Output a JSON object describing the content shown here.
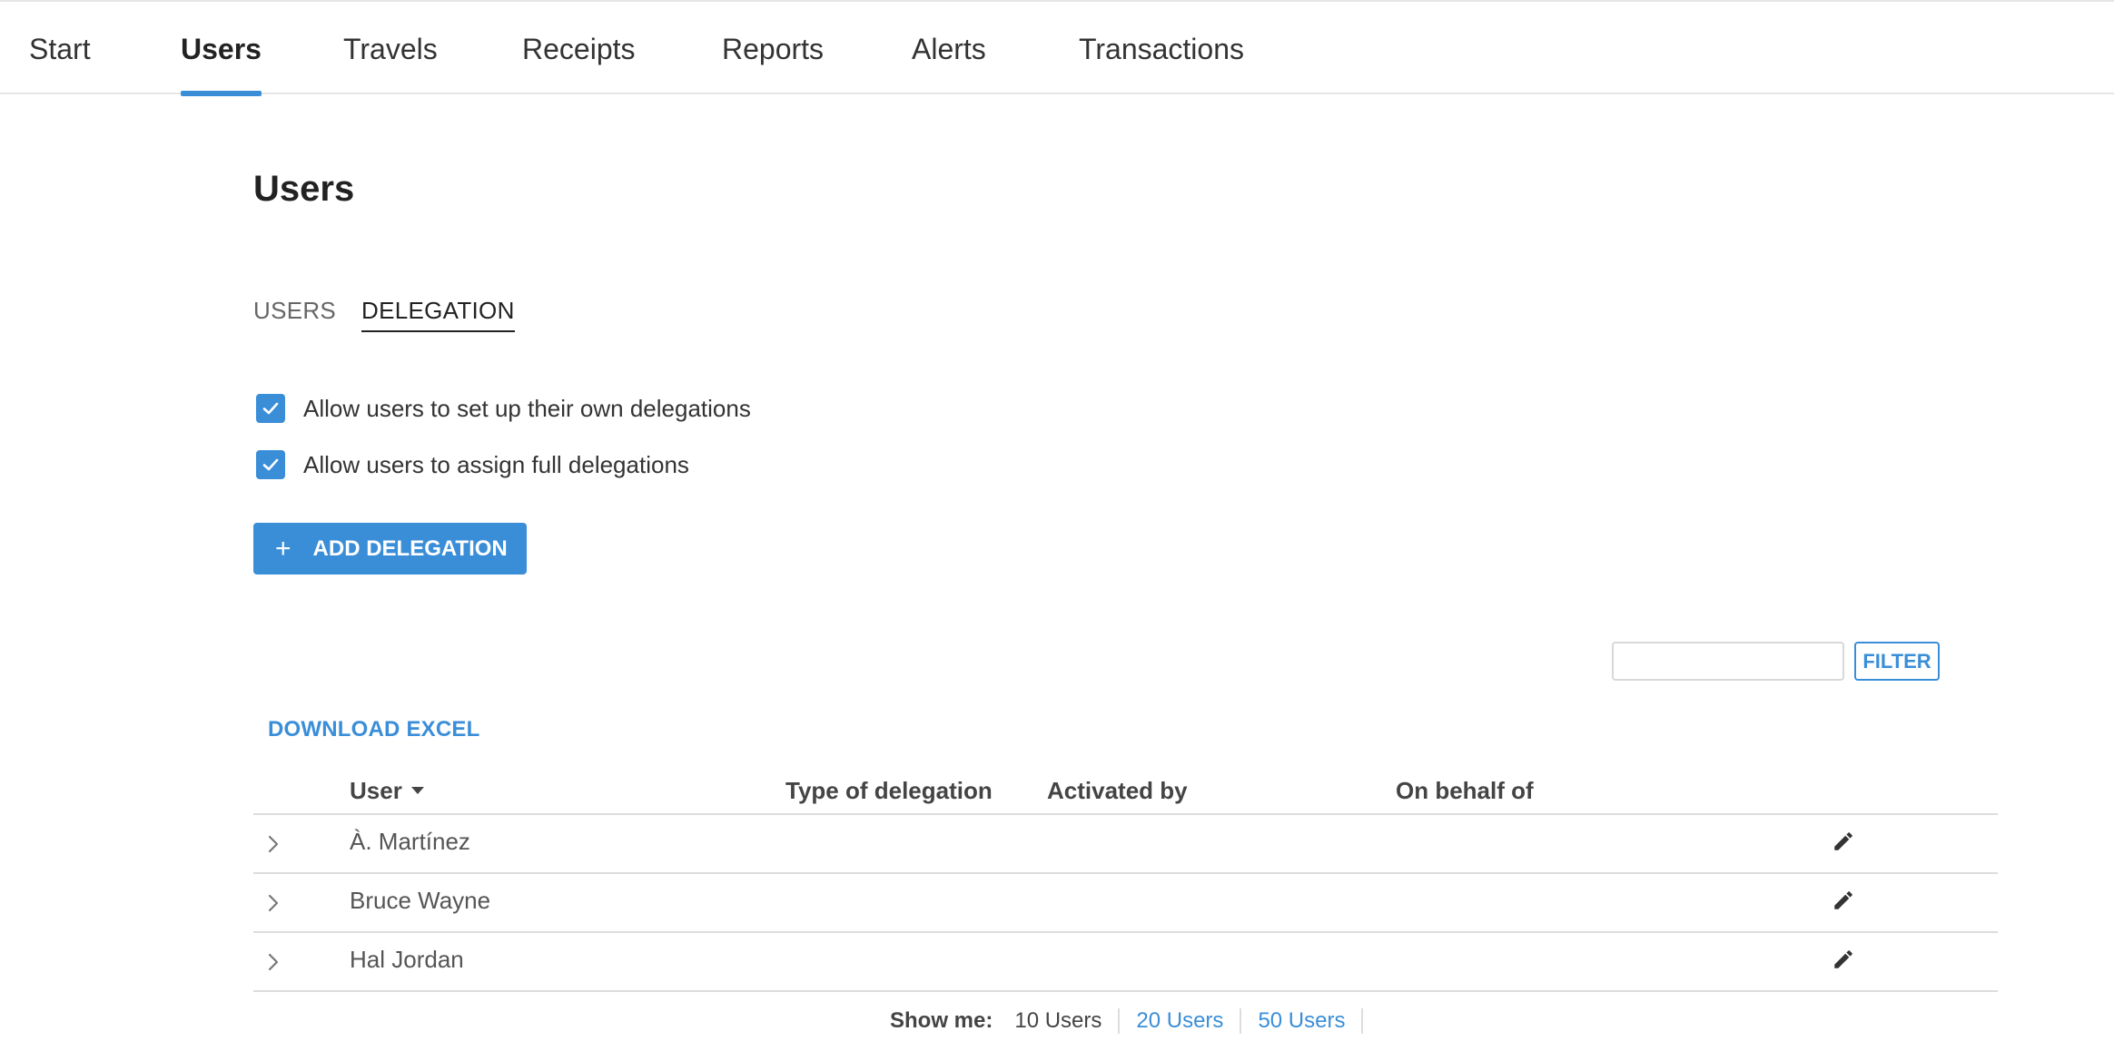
{
  "nav": {
    "items": [
      {
        "label": "Start"
      },
      {
        "label": "Users"
      },
      {
        "label": "Travels"
      },
      {
        "label": "Receipts"
      },
      {
        "label": "Reports"
      },
      {
        "label": "Alerts"
      },
      {
        "label": "Transactions"
      }
    ],
    "active_index": 1
  },
  "page": {
    "title": "Users"
  },
  "subtabs": [
    {
      "label": "USERS",
      "active": false
    },
    {
      "label": "DELEGATION",
      "active": true
    }
  ],
  "settings": [
    {
      "label": "Allow users to set up their own delegations",
      "checked": true
    },
    {
      "label": "Allow users to assign full delegations",
      "checked": true
    }
  ],
  "add_button": {
    "icon": "+",
    "label": "ADD DELEGATION"
  },
  "search": {
    "value": "",
    "placeholder": "",
    "icon": "search-icon"
  },
  "filter_button": {
    "label": "FILTER"
  },
  "download": {
    "label": "DOWNLOAD EXCEL"
  },
  "table": {
    "columns": [
      {
        "label": "User",
        "sorted": "desc"
      },
      {
        "label": "Type of delegation"
      },
      {
        "label": "Activated by"
      },
      {
        "label": "On behalf of"
      }
    ],
    "rows": [
      {
        "user": "À. Martínez",
        "type": "",
        "activated_by": "",
        "on_behalf_of": ""
      },
      {
        "user": "Bruce Wayne",
        "type": "",
        "activated_by": "",
        "on_behalf_of": ""
      },
      {
        "user": "Hal Jordan",
        "type": "",
        "activated_by": "",
        "on_behalf_of": ""
      }
    ]
  },
  "pager": {
    "label": "Show me:",
    "options": [
      {
        "label": "10 Users",
        "current": true
      },
      {
        "label": "20 Users",
        "current": false
      },
      {
        "label": "50 Users",
        "current": false
      }
    ]
  },
  "colors": {
    "accent": "#3a8ed8",
    "text": "#333333",
    "border": "#dcdcdc"
  }
}
